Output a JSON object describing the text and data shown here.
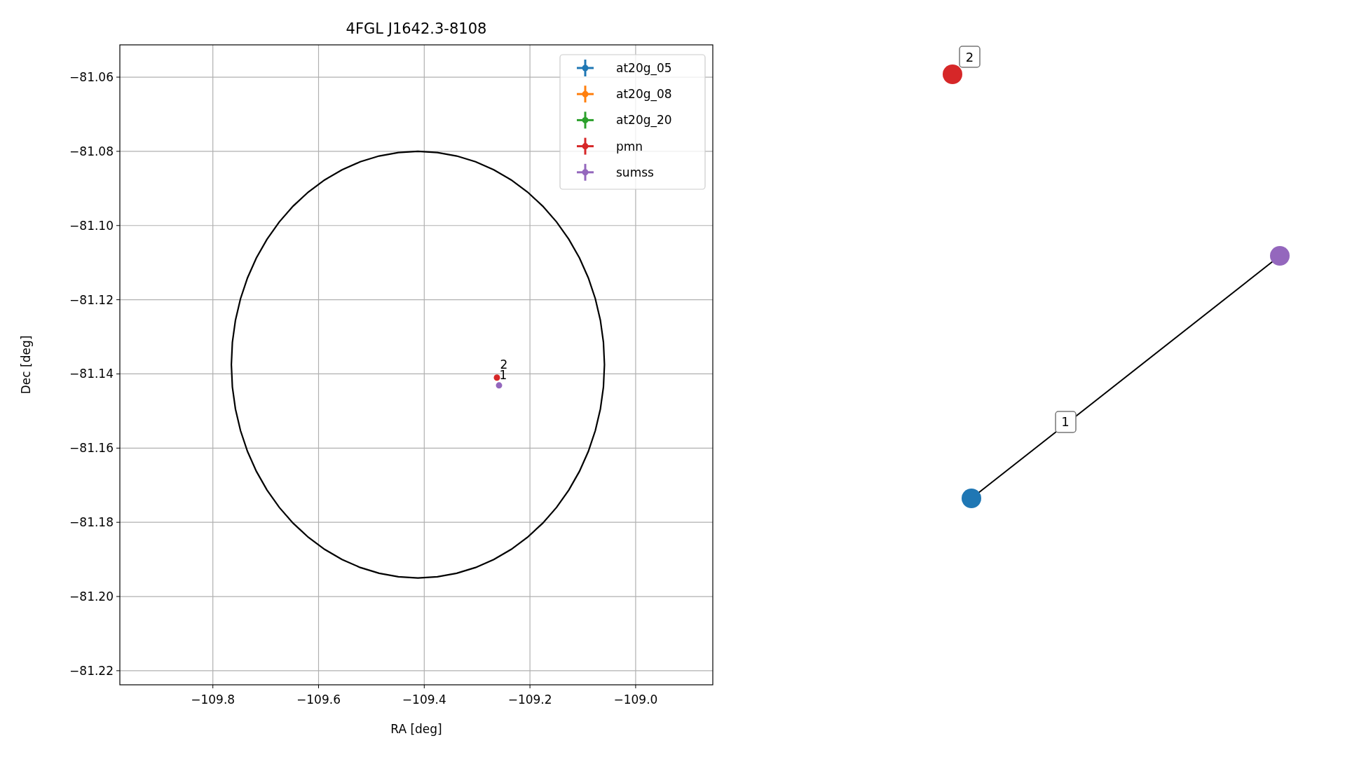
{
  "plot": {
    "chart_data": {
      "type": "scatter",
      "title": "4FGL J1642.3-8108",
      "xlabel": "RA [deg]",
      "ylabel": "Dec [deg]",
      "xlim": [
        -109.976,
        -108.854
      ],
      "ylim": [
        -81.2238,
        -81.0513
      ],
      "grid": true,
      "legend": true,
      "xticks": [
        {
          "value": -109.8,
          "label": "−109.8"
        },
        {
          "value": -109.6,
          "label": "−109.6"
        },
        {
          "value": -109.4,
          "label": "−109.4"
        },
        {
          "value": -109.2,
          "label": "−109.2"
        },
        {
          "value": -109.0,
          "label": "−109.0"
        }
      ],
      "yticks": [
        {
          "value": -81.06,
          "label": "−81.06"
        },
        {
          "value": -81.08,
          "label": "−81.08"
        },
        {
          "value": -81.1,
          "label": "−81.10"
        },
        {
          "value": -81.12,
          "label": "−81.12"
        },
        {
          "value": -81.14,
          "label": "−81.14"
        },
        {
          "value": -81.16,
          "label": "−81.16"
        },
        {
          "value": -81.18,
          "label": "−81.18"
        },
        {
          "value": -81.2,
          "label": "−81.20"
        },
        {
          "value": -81.22,
          "label": "−81.22"
        }
      ],
      "series": [
        {
          "name": "at20g_05",
          "color": "#1f77b4"
        },
        {
          "name": "at20g_08",
          "color": "#ff7f0e"
        },
        {
          "name": "at20g_20",
          "color": "#2ca02c"
        },
        {
          "name": "pmn",
          "color": "#d62728",
          "x": [
            -109.2625
          ],
          "values": [
            -81.141
          ]
        },
        {
          "name": "sumss",
          "color": "#9467bd",
          "x": [
            -109.2585
          ],
          "values": [
            -81.1431
          ]
        }
      ],
      "annotations": [
        "2",
        "1"
      ]
    }
  },
  "graph": {
    "nodes": [
      {
        "color": "#1f77b4"
      },
      {
        "color": "#9467bd"
      },
      {
        "color": "#d62728",
        "label": "2"
      }
    ],
    "edges": [
      {
        "label": "1"
      }
    ]
  }
}
